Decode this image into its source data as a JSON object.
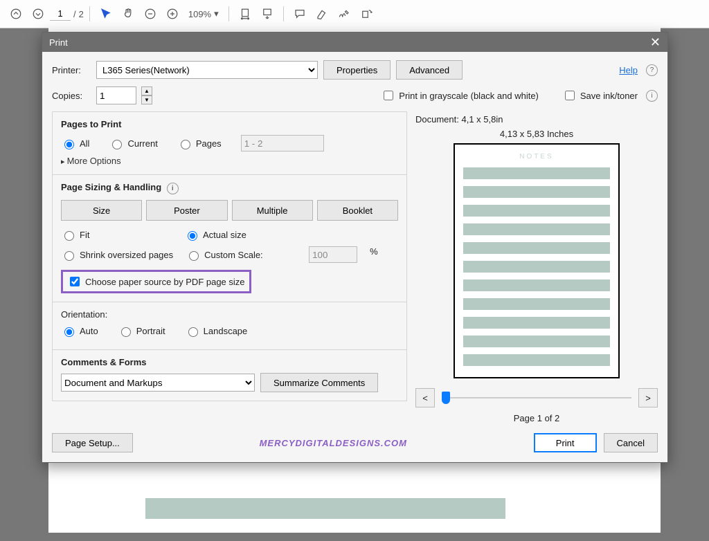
{
  "toolbar": {
    "page_current": "1",
    "page_sep": "/",
    "page_total": "2",
    "zoom": "109%",
    "zoom_caret": "▾"
  },
  "dialog": {
    "title": "Print",
    "close": "✕",
    "printer_label": "Printer:",
    "printer_value": "L365 Series(Network)",
    "properties": "Properties",
    "advanced": "Advanced",
    "help": "Help",
    "copies_label": "Copies:",
    "copies_value": "1",
    "grayscale": "Print in grayscale (black and white)",
    "save_ink": "Save ink/toner"
  },
  "pages": {
    "title": "Pages to Print",
    "all": "All",
    "current": "Current",
    "pages": "Pages",
    "range": "1 - 2",
    "more": "More Options"
  },
  "sizing": {
    "title": "Page Sizing & Handling",
    "size": "Size",
    "poster": "Poster",
    "multiple": "Multiple",
    "booklet": "Booklet",
    "fit": "Fit",
    "actual": "Actual size",
    "shrink": "Shrink oversized pages",
    "custom": "Custom Scale:",
    "custom_val": "100",
    "pct": "%",
    "choose_paper": "Choose paper source by PDF page size"
  },
  "orientation": {
    "title": "Orientation:",
    "auto": "Auto",
    "portrait": "Portrait",
    "landscape": "Landscape"
  },
  "comments": {
    "title": "Comments & Forms",
    "value": "Document and Markups",
    "summarize": "Summarize Comments"
  },
  "preview": {
    "doc": "Document: 4,1 x 5,8in",
    "dim": "4,13 x 5,83 Inches",
    "notes": "NOTES",
    "prev": "<",
    "next": ">",
    "page": "Page 1 of 2"
  },
  "footer": {
    "page_setup": "Page Setup...",
    "watermark": "MERCYDIGITALDESIGNS.COM",
    "print": "Print",
    "cancel": "Cancel"
  }
}
